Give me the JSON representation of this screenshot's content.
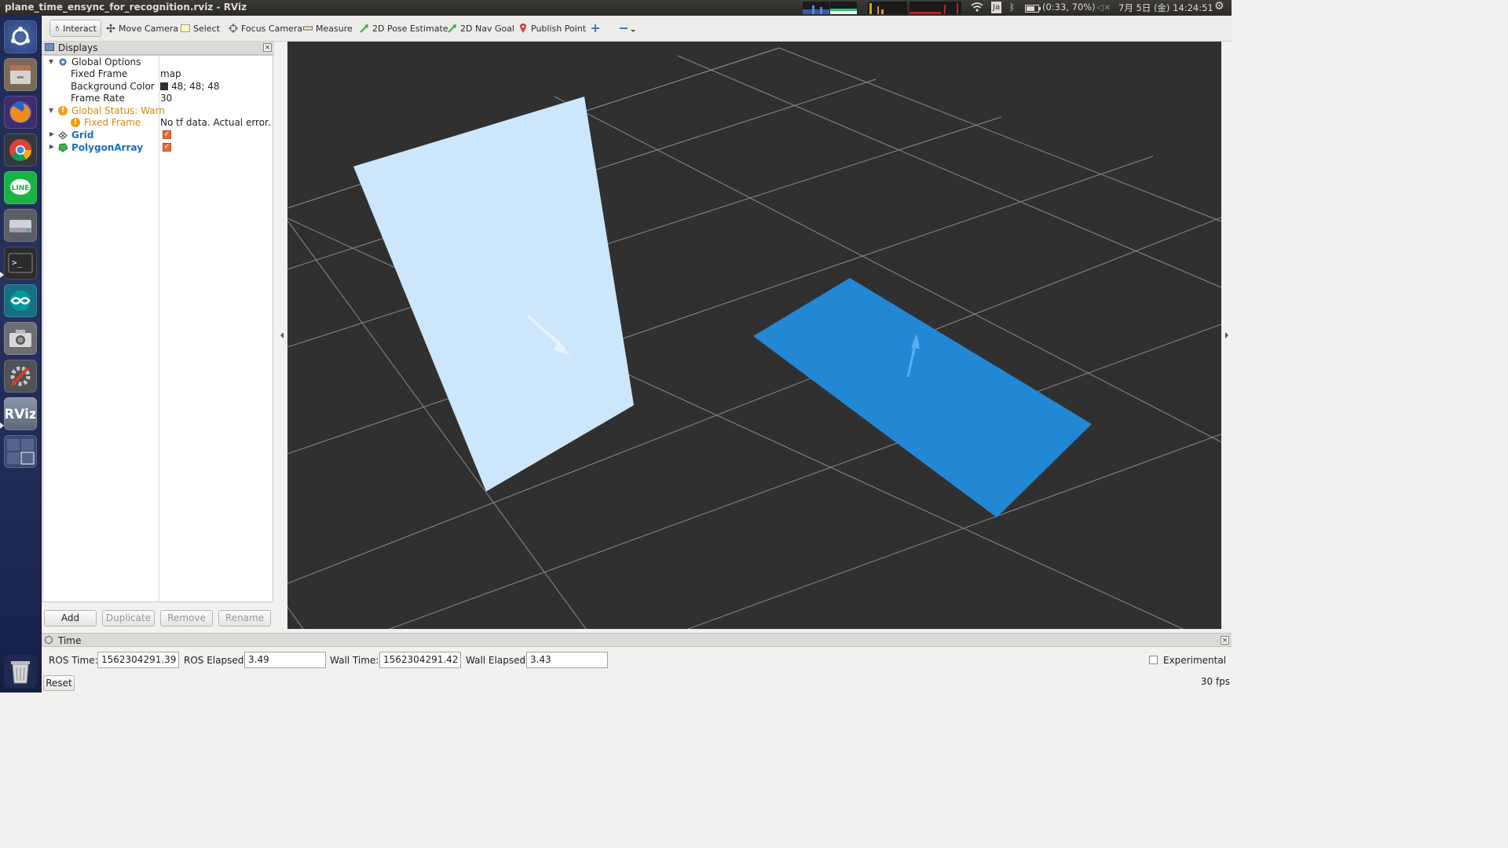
{
  "window": {
    "title": "plane_time_ensync_for_recognition.rviz - RViz"
  },
  "system_tray": {
    "input_method": "Ja",
    "battery": "(0:33, 70%)",
    "datetime": "7月 5日 (金) 14:24:51"
  },
  "launcher": {
    "items": [
      "ubuntu-dash",
      "files",
      "firefox",
      "chrome",
      "line",
      "disk",
      "terminal",
      "arduino",
      "camera",
      "settings",
      "rviz",
      "workspaces",
      "trash"
    ]
  },
  "toolbar": {
    "tools": [
      {
        "label": "Interact",
        "icon": "hand-icon",
        "active": true
      },
      {
        "label": "Move Camera",
        "icon": "move-icon"
      },
      {
        "label": "Select",
        "icon": "select-icon"
      },
      {
        "label": "Focus Camera",
        "icon": "focus-icon"
      },
      {
        "label": "Measure",
        "icon": "ruler-icon"
      },
      {
        "label": "2D Pose Estimate",
        "icon": "green-arrow-icon"
      },
      {
        "label": "2D Nav Goal",
        "icon": "green-arrow-icon"
      },
      {
        "label": "Publish Point",
        "icon": "pin-icon"
      }
    ]
  },
  "displays": {
    "title": "Displays",
    "rows": [
      {
        "name": "Global Options",
        "value": ""
      },
      {
        "name": "Fixed Frame",
        "value": "map"
      },
      {
        "name": "Background Color",
        "value": "48; 48; 48"
      },
      {
        "name": "Frame Rate",
        "value": "30"
      },
      {
        "name": "Global Status: Warn",
        "value": ""
      },
      {
        "name": "Fixed Frame",
        "value": "No tf data.  Actual error..."
      },
      {
        "name": "Grid",
        "value": ""
      },
      {
        "name": "PolygonArray",
        "value": ""
      }
    ],
    "buttons": {
      "add": "Add",
      "duplicate": "Duplicate",
      "remove": "Remove",
      "rename": "Rename"
    }
  },
  "viewport": {
    "background_color": "#303030",
    "grid_color": "#8a8a8a",
    "plane1_color": "#cce6fb",
    "plane2_color": "#2288d4"
  },
  "time": {
    "title": "Time",
    "ros_time_label": "ROS Time:",
    "ros_time": "1562304291.39",
    "ros_elapsed_label": "ROS Elapsed:",
    "ros_elapsed": "3.49",
    "wall_time_label": "Wall Time:",
    "wall_time": "1562304291.42",
    "wall_elapsed_label": "Wall Elapsed:",
    "wall_elapsed": "3.43",
    "experimental_label": "Experimental"
  },
  "status": {
    "reset": "Reset",
    "fps": "30 fps"
  }
}
